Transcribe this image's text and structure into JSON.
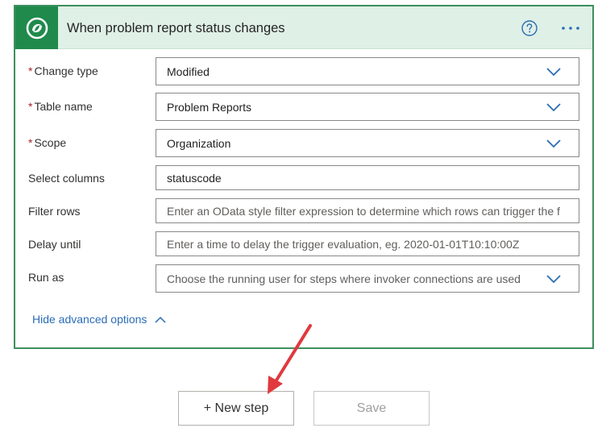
{
  "trigger": {
    "title": "When problem report status changes",
    "help_icon": "question-circle-icon",
    "more_icon": "ellipsis-icon",
    "logo_icon": "dataverse-logo-icon",
    "colors": {
      "header_bg": "#dff0e6",
      "border": "#3f8f5e",
      "logo_bg": "#1f8a4c",
      "link": "#2b6cb6"
    }
  },
  "fields": [
    {
      "label": "Change type",
      "required": "*",
      "value": "Modified"
    },
    {
      "label": "Table name",
      "required": "*",
      "value": "Problem Reports"
    },
    {
      "label": "Scope",
      "required": "*",
      "value": "Organization"
    },
    {
      "label": "Select columns",
      "value": "statuscode"
    },
    {
      "label": "Filter rows",
      "placeholder": "Enter an OData style filter expression to determine which rows can trigger the f"
    },
    {
      "label": "Delay until",
      "placeholder": "Enter a time to delay the trigger evaluation, eg. 2020-01-01T10:10:00Z"
    },
    {
      "label": "Run as",
      "placeholder": "Choose the running user for steps where invoker connections are used"
    }
  ],
  "advanced": {
    "label": "Hide advanced options"
  },
  "buttons": {
    "new_step": "+ New step",
    "save": "Save"
  }
}
